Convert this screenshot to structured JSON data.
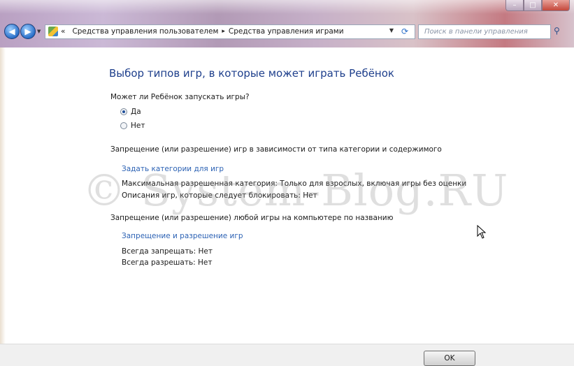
{
  "window": {
    "controls": {
      "minimize": "–",
      "maximize": "□",
      "close": "✕"
    }
  },
  "nav": {
    "back_icon": "back-arrow-icon",
    "forward_icon": "forward-arrow-icon",
    "breadcrumb_prefix": "«",
    "breadcrumbs": [
      "Средства управления пользователем",
      "Средства управления играми"
    ],
    "breadcrumb_separator": "▸",
    "search_placeholder": "Поиск в панели управления"
  },
  "main": {
    "heading": "Выбор типов игр, в которые может играть Ребёнок",
    "question": "Может ли Ребёнок запускать игры?",
    "options": [
      {
        "label": "Да",
        "checked": true
      },
      {
        "label": "Нет",
        "checked": false
      }
    ],
    "section1": {
      "title": "Запрещение (или разрешение) игр в зависимости от типа категории и содержимого",
      "link": "Задать категории для игр",
      "max_category": "Максимальная разрешенная категория: Только для взрослых, включая игры без оценки",
      "blocked_descriptions": "Описания игр, которые следует блокировать: Нет"
    },
    "section2": {
      "title": "Запрещение (или разрешение) любой игры на компьютере по названию",
      "link": "Запрещение и разрешение игр",
      "always_block": "Всегда запрещать: Нет",
      "always_allow": "Всегда разрешать: Нет"
    },
    "watermark": "© System-Blog.RU"
  },
  "footer": {
    "ok_label": "OK"
  },
  "colors": {
    "heading": "#1e3f8c",
    "link": "#2c62b4",
    "text": "#1a1a1a"
  }
}
